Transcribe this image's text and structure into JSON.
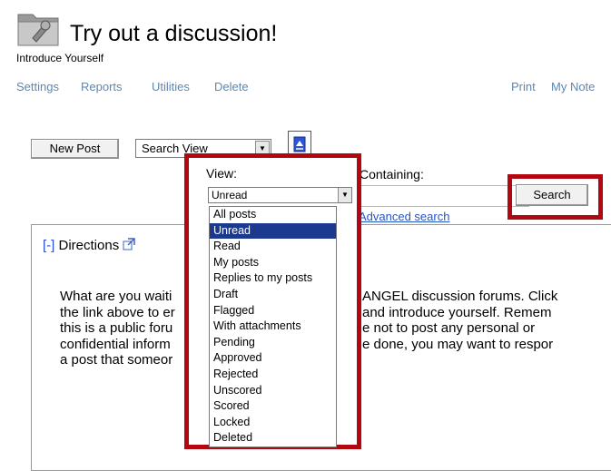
{
  "header": {
    "title": "Try out a discussion!",
    "subtitle": "Introduce Yourself",
    "icon": "discussion-folder-icon"
  },
  "toplinks": {
    "left": [
      "Settings",
      "Reports",
      "Utilities",
      "Delete"
    ],
    "right": [
      "Print",
      "My Note"
    ]
  },
  "toolbar": {
    "new_post_label": "New Post",
    "view_mode_value": "Search View"
  },
  "search": {
    "view_label": "View:",
    "view_value": "Unread",
    "containing_label": "Containing:",
    "containing_value": "",
    "search_button": "Search",
    "advanced_link": "Advanced search",
    "options": [
      "All posts",
      "Unread",
      "Read",
      "My posts",
      "Replies to my posts",
      "Draft",
      "Flagged",
      "With attachments",
      "Pending",
      "Approved",
      "Rejected",
      "Unscored",
      "Scored",
      "Locked",
      "Deleted"
    ],
    "selected_option": "Unread"
  },
  "directions": {
    "toggle": "[-]",
    "heading": "Directions",
    "lines": [
      "What are you waiti",
      "the link above to er",
      "this is a public foru",
      "confidential inform",
      "a post that someor"
    ],
    "lines_right": [
      "ANGEL discussion forums.  Click",
      "and introduce yourself.  Remem",
      "e not to post any personal or",
      "e done, you may want to respor",
      ""
    ]
  },
  "colors": {
    "highlight_frame": "#b20710",
    "link": "#5b87b5",
    "selected_option_bg": "#1b3a8f"
  }
}
